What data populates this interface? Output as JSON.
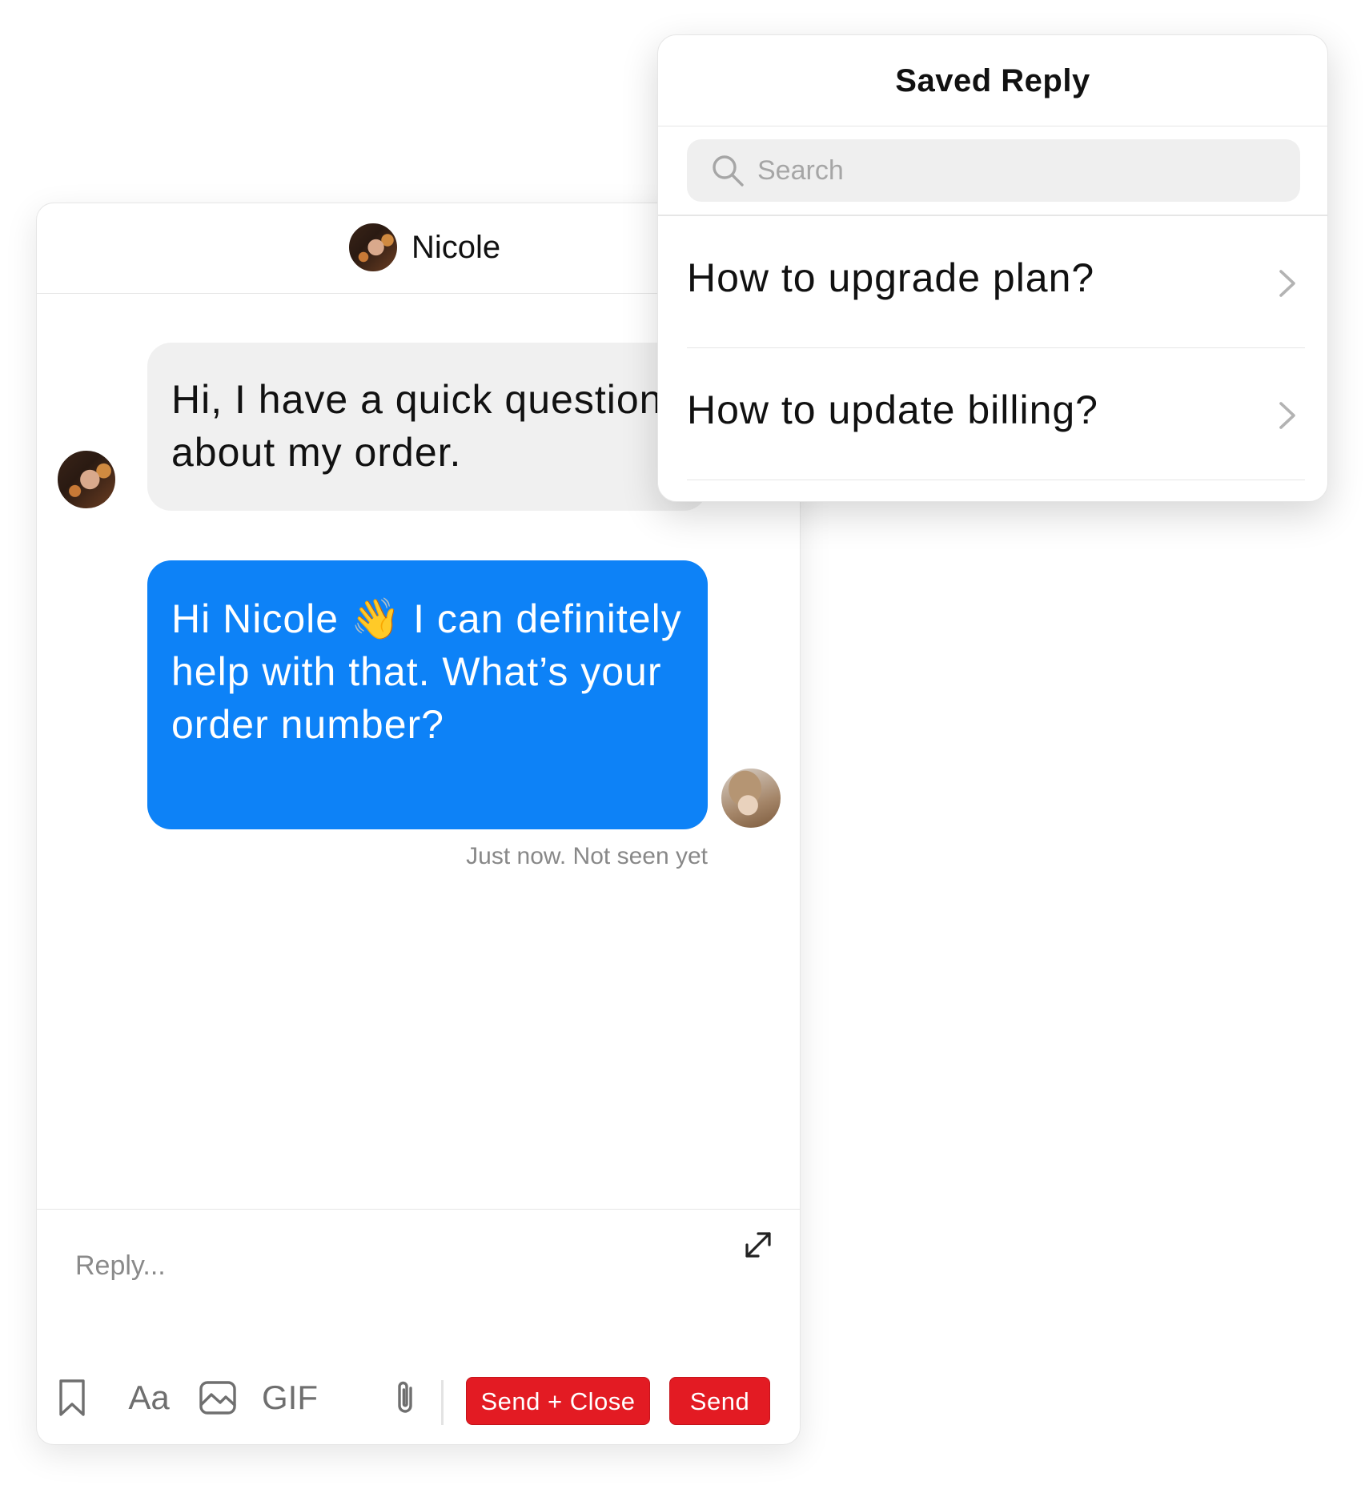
{
  "chat": {
    "contact_name": "Nicole",
    "messages": [
      {
        "from": "contact",
        "text": "Hi, I have a quick question about my order."
      },
      {
        "from": "agent",
        "text": "Hi Nicole 👋 I can definitely help with that. What’s your order number?"
      }
    ],
    "status": "Just now. Not seen yet"
  },
  "composer": {
    "placeholder": "Reply...",
    "tools": {
      "font_label": "Aa",
      "gif_label": "GIF"
    },
    "send_close_label": "Send + Close",
    "send_label": "Send"
  },
  "saved_reply": {
    "title": "Saved Reply",
    "search_placeholder": "Search",
    "items": [
      {
        "label": "How to upgrade plan?"
      },
      {
        "label": "How to update billing?"
      }
    ]
  },
  "icons": {
    "bookmark": "bookmark-icon",
    "font": "font-format-icon",
    "image": "image-icon",
    "gif": "gif-icon",
    "attachment": "paperclip-icon",
    "expand": "expand-icon",
    "search": "search-icon",
    "chevron": "chevron-right-icon"
  },
  "colors": {
    "outgoing_bubble": "#0d82f7",
    "incoming_bubble": "#f0f0f0",
    "send_button": "#e31b23"
  }
}
